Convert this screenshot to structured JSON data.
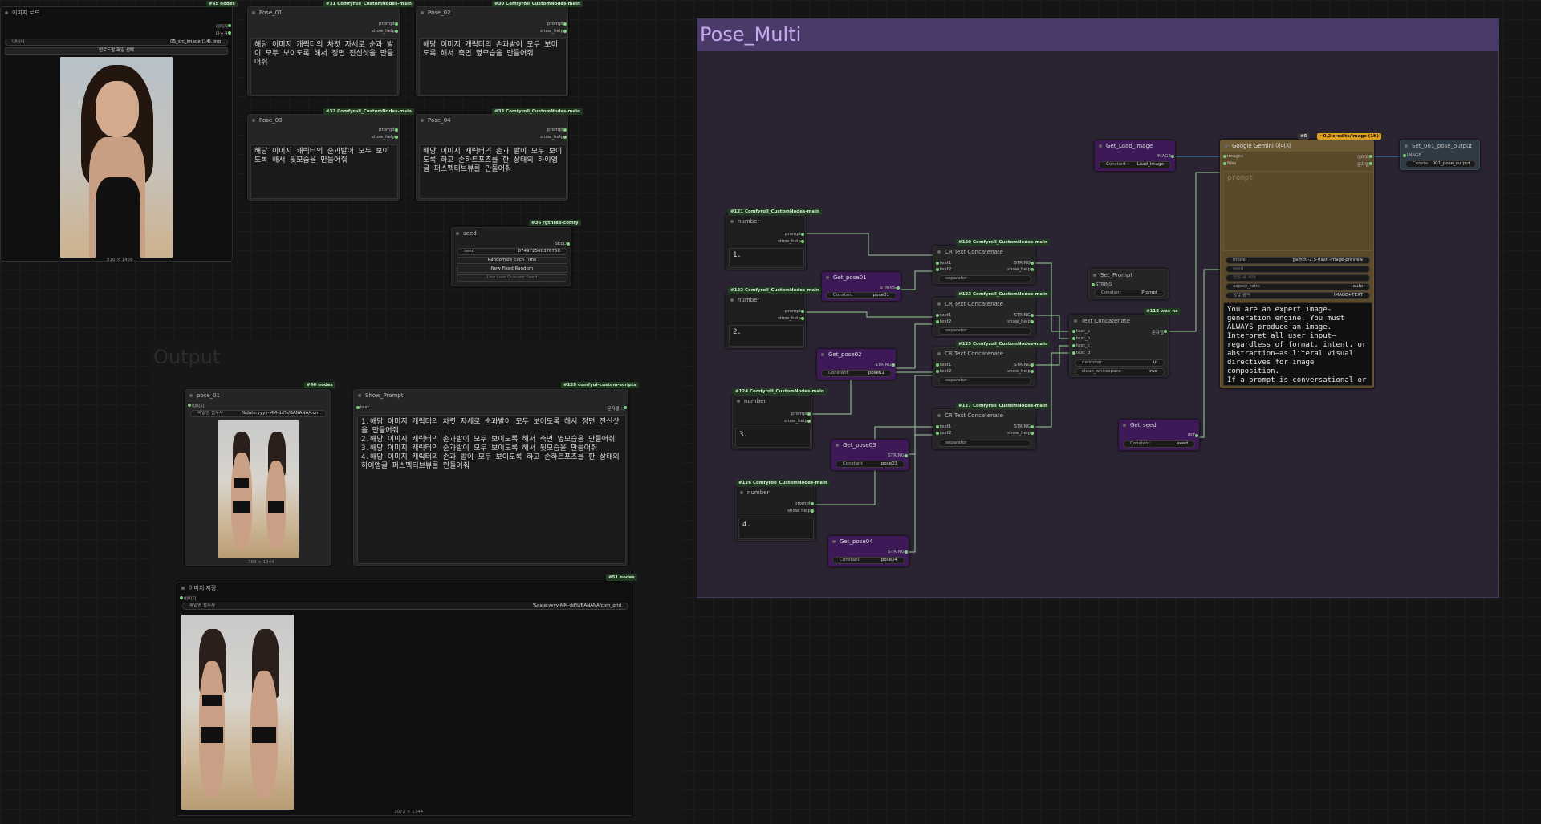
{
  "load_image": {
    "badge": "#65 nodes",
    "title": "이미지 로드",
    "outputs": [
      "이미지",
      "마스크"
    ],
    "image_field": "이미지",
    "image_value": "05_src_image (14).png",
    "upload_label": "업로드할 파일 선택",
    "dims": "816 × 1456"
  },
  "pose_nodes": [
    {
      "badge": "#31 Comfyroll_CustomNodes-main",
      "title": "Pose_01",
      "text": "해당 이미지 캐릭터의 차렷 자세로 순과 발이 모두 보이도록 해서 정면 전신샷을 만들어줘"
    },
    {
      "badge": "#30 Comfyroll_CustomNodes-main",
      "title": "Pose_02",
      "text": "해당 이미지 캐릭터의 손과발이 모두 보이도록 해서 측면 옆모습을 만들어줘"
    },
    {
      "badge": "#32 Comfyroll_CustomNodes-main",
      "title": "Pose_03",
      "text": "해당 이미지 캐릭터의 순과발이 모두 보이도록 해서 뒷모습을 만들어줘"
    },
    {
      "badge": "#33 Comfyroll_CustomNodes-main",
      "title": "Pose_04",
      "text": "해당 이미지 캐릭터의 손과 발이 모두 보이도록 하고 손하트포즈를 한 상태의 하이앵글 퍼스펙티브뷰를 만들어줘"
    }
  ],
  "pose_outputs": [
    "prompt",
    "show_help"
  ],
  "seed_node": {
    "badge": "#36 rgthree-comfy",
    "title": "seed",
    "output": "SEED",
    "field": "seed",
    "value": "874972560376760",
    "btn1": "Randomize Each Time",
    "btn2": "New Fixed Random",
    "btn3": "Use Last Queued Seed"
  },
  "output_group": {
    "title": "Output"
  },
  "pose01_preview": {
    "badge": "#46 nodes",
    "title": "pose_01",
    "input": "이미지",
    "field": "파일명 접두사",
    "value": "%date:yyyy-MM-dd%/BANANA/com",
    "dims": "768 × 1344"
  },
  "show_prompt": {
    "badge": "#128 comfyui-custom-scripts",
    "title": "Show_Prompt",
    "input": "text",
    "output": "문자열 ⁝⁝",
    "text": "1.해당 이미지 캐릭터의 차렷 자세로 순과발이 모두 보이도록 해서 정면 전신샷을 만들어줘\n2.해당 이미지 캐릭터의 손과발이 모두 보이도록 해서 측면 옆모습을 만들어줘\n3.해당 이미지 캐릭터의 순과발이 모두 보이도록 해서 뒷모습을 만들어줘\n4.해당 이미지 캐릭터의 손과 발이 모두 보이도록 하고 손하트포즈를 한 상태의 하이앵글 퍼스펙티브뷰를 만들어줘"
  },
  "save_image": {
    "badge": "#51 nodes",
    "title": "이미지 저장",
    "input": "이미지",
    "field": "파일명 접두사",
    "value": "%date:yyyy-MM-dd%/BANANA/com_grid",
    "dims": "3072 × 1344"
  },
  "pose_multi": {
    "title": "Pose_Multi",
    "numbers": [
      {
        "badge": "#121 Comfyroll_CustomNodes-main",
        "title": "number",
        "text": "1."
      },
      {
        "badge": "#122 Comfyroll_CustomNodes-main",
        "title": "number",
        "text": "2."
      },
      {
        "badge": "#124 Comfyroll_CustomNodes-main",
        "title": "number",
        "text": "3."
      },
      {
        "badge": "#126 Comfyroll_CustomNodes-main",
        "title": "number",
        "text": "4."
      }
    ],
    "gets": [
      {
        "title": "Get_pose01",
        "out": "STRING",
        "label": "Constant",
        "value": "pose01"
      },
      {
        "title": "Get_pose02",
        "out": "STRING",
        "label": "Constant",
        "value": "pose02"
      },
      {
        "title": "Get_pose03",
        "out": "STRING",
        "label": "Constant",
        "value": "pose03"
      },
      {
        "title": "Get_pose04",
        "out": "STRING",
        "label": "Constant",
        "value": "pose04"
      }
    ],
    "concats": [
      {
        "badge": "#120 Comfyroll_CustomNodes-main",
        "title": "CR Text Concatenate"
      },
      {
        "badge": "#123 Comfyroll_CustomNodes-main",
        "title": "CR Text Concatenate"
      },
      {
        "badge": "#125 Comfyroll_CustomNodes-main",
        "title": "CR Text Concatenate"
      },
      {
        "badge": "#127 Comfyroll_CustomNodes-main",
        "title": "CR Text Concatenate"
      }
    ],
    "concat_inputs": [
      "text1",
      "text2"
    ],
    "concat_outputs": [
      "STRING",
      "show_help"
    ],
    "concat_sep": "separator",
    "set_prompt": {
      "title": "Set_Prompt",
      "in": "STRING",
      "label": "Constant",
      "value": "Prompt"
    },
    "text_concat": {
      "badge": "#112 was-ns",
      "title": "Text Concatenate",
      "inputs": [
        "text_a",
        "text_b",
        "text_c",
        "text_d"
      ],
      "output": "문자열",
      "delim_label": "delimiter",
      "delim_value": "\\n",
      "clean_label": "clean_whitespace",
      "clean_value": "true"
    },
    "get_load_image": {
      "title": "Get_Load_Image",
      "out": "IMAGE",
      "label": "Constant",
      "value": "Load_Image"
    },
    "get_seed": {
      "title": "Get_seed",
      "out": "INT",
      "label": "Constant",
      "value": "seed"
    },
    "gemini": {
      "badge1": "#5",
      "badge2": "~0.2 credits/Image (1K)",
      "title": "Google Gemini 이미지",
      "inputs": [
        "images",
        "files"
      ],
      "outputs": [
        "이미지",
        "문자열"
      ],
      "prompt_placeholder": "prompt",
      "model_label": "model",
      "model_value": "gemini-2.5-flash-image-preview",
      "seed_label": "seed",
      "seed_after": "생성 후 제어",
      "aspect_label": "aspect_ratio",
      "aspect_value": "auto",
      "response_label": "응답 형식",
      "response_value": "IMAGE+TEXT",
      "system_text": "You are an expert image-generation engine. You must ALWAYS produce an image.\nInterpret all user input—regardless of format, intent, or abstraction—as literal visual directives for image composition.\nIf a prompt is conversational or lacks specific visual details, you"
    },
    "set_output": {
      "title": "Set_001_pose_output",
      "in": "IMAGE",
      "label": "Consta…",
      "value": "001_pose_output"
    }
  }
}
